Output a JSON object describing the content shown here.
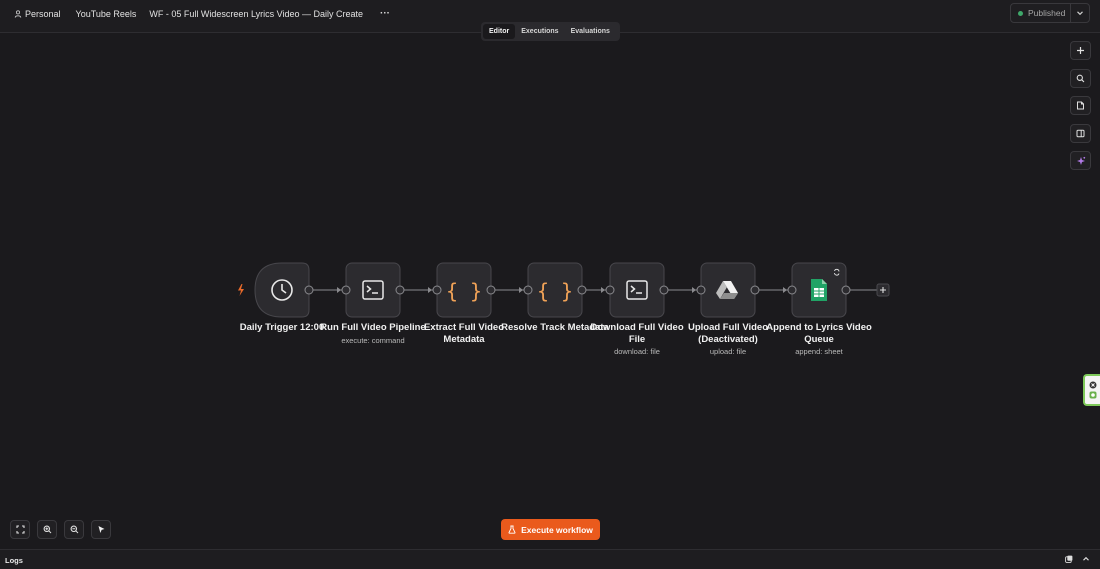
{
  "header": {
    "personal": "Personal",
    "project": "YouTube Reels",
    "workflow_name": "WF - 05 Full Widescreen Lyrics Video — Daily Create",
    "more": "···",
    "publish_label": "Published"
  },
  "tabs": [
    {
      "label": "Editor"
    },
    {
      "label": "Executions"
    },
    {
      "label": "Evaluations"
    }
  ],
  "nodes": [
    {
      "name": "Daily Trigger 12:00",
      "subtitle": "",
      "icon": "clock-icon"
    },
    {
      "name": "Run Full Video Pipeline",
      "subtitle": "execute: command",
      "icon": "terminal-icon"
    },
    {
      "name": "Extract Full Video Metadata",
      "subtitle": "",
      "icon": "code-braces-icon"
    },
    {
      "name": "Resolve Track Metadata",
      "subtitle": "",
      "icon": "code-braces-icon"
    },
    {
      "name": "Download Full Video File",
      "subtitle": "download: file",
      "icon": "terminal-icon"
    },
    {
      "name": "Upload Full Video (Deactivated)",
      "subtitle": "upload: file",
      "icon": "google-drive-icon"
    },
    {
      "name": "Append to Lyrics Video Queue",
      "subtitle": "append: sheet",
      "icon": "google-sheets-icon"
    }
  ],
  "actions": {
    "execute_label": "Execute workflow"
  },
  "logs": {
    "label": "Logs"
  },
  "colors": {
    "background": "#1b1a1d",
    "accent": "#ea5a1c",
    "code_icon": "#f0a257",
    "sheets_green": "#21a366",
    "published_dot": "#3fa86a"
  }
}
